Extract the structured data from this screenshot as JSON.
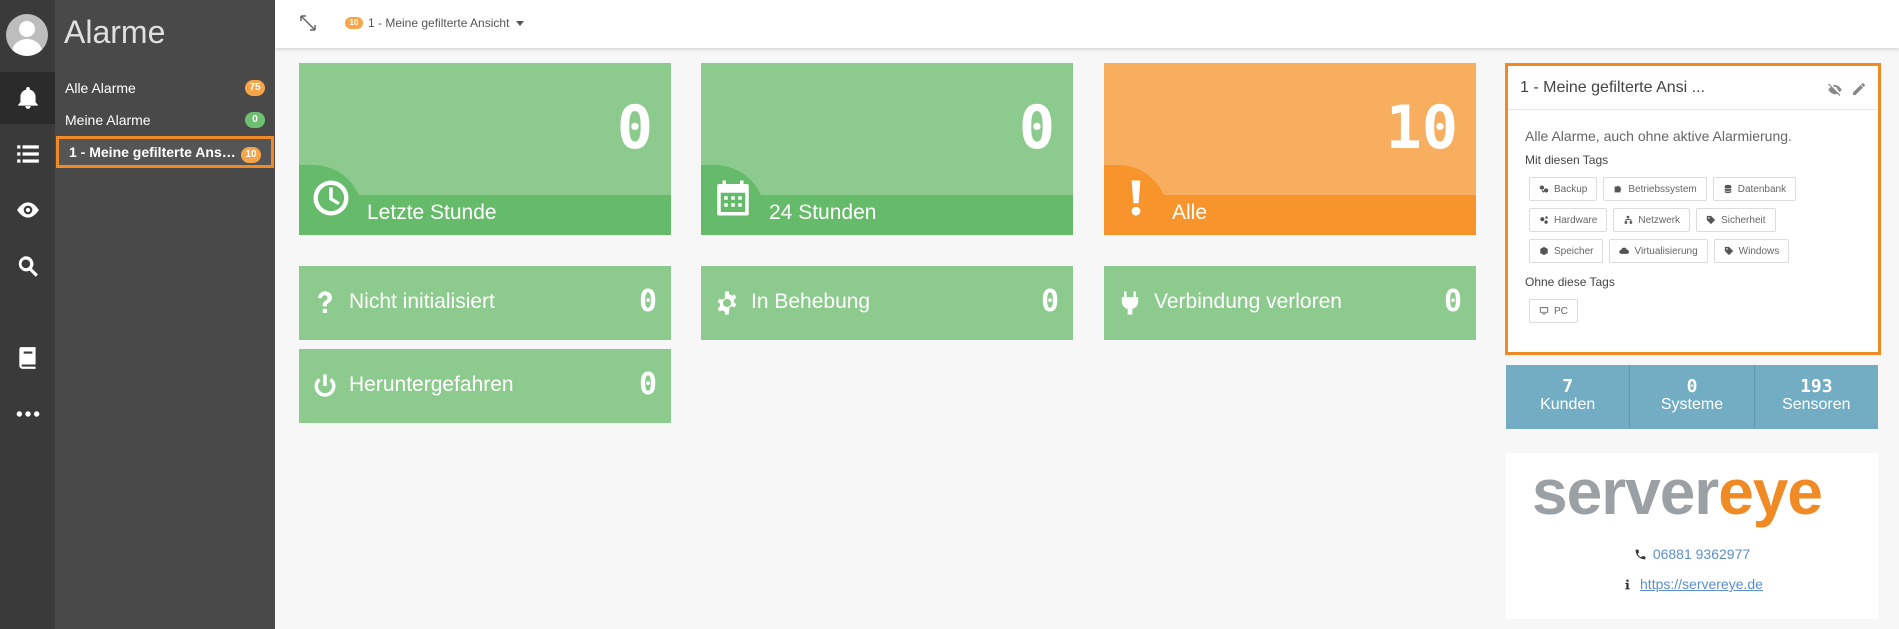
{
  "app": {
    "title": "Alarme"
  },
  "sidebar": {
    "items": [
      {
        "label": "Alle Alarme",
        "badge": "75",
        "badge_color": "#f7a54a"
      },
      {
        "label": "Meine Alarme",
        "badge": "0",
        "badge_color": "#6fbf73"
      },
      {
        "label": "1 - Meine gefilterte Ansicht",
        "badge": "10",
        "badge_color": "#f7a54a"
      }
    ]
  },
  "topbar": {
    "view_badge": "10",
    "view_label": "1 - Meine gefilterte Ansicht"
  },
  "tiles": [
    {
      "label": "Letzte Stunde",
      "value": "0",
      "icon": "clock-icon",
      "color": "#8dca8e"
    },
    {
      "label": "24 Stunden",
      "value": "0",
      "icon": "calendar-icon",
      "color": "#8dca8e"
    },
    {
      "label": "Alle",
      "value": "10",
      "icon": "exclamation-icon",
      "color": "#f7ae5f"
    }
  ],
  "small_tiles": [
    {
      "label": "Nicht initialisiert",
      "value": "0",
      "icon": "question-icon"
    },
    {
      "label": "In Behebung",
      "value": "0",
      "icon": "gear-icon"
    },
    {
      "label": "Verbindung verloren",
      "value": "0",
      "icon": "plug-icon"
    },
    {
      "label": "Heruntergefahren",
      "value": "0",
      "icon": "power-icon"
    }
  ],
  "filter_panel": {
    "title": "1 - Meine gefilterte Ansi ...",
    "description": "Alle Alarme, auch ohne aktive Alarmierung.",
    "with_tags_label": "Mit diesen Tags",
    "with_tags": [
      "Backup",
      "Betriebssystem",
      "Datenbank",
      "Hardware",
      "Netzwerk",
      "Sicherheit",
      "Speicher",
      "Virtualisierung",
      "Windows"
    ],
    "without_tags_label": "Ohne diese Tags",
    "without_tags": [
      "PC"
    ]
  },
  "stats": [
    {
      "value": "7",
      "label": "Kunden"
    },
    {
      "value": "0",
      "label": "Systeme"
    },
    {
      "value": "193",
      "label": "Sensoren"
    }
  ],
  "brand": {
    "logo_part1": "server",
    "logo_part2": "eye",
    "phone": "06881 9362977",
    "url": "https://servereye.de"
  }
}
